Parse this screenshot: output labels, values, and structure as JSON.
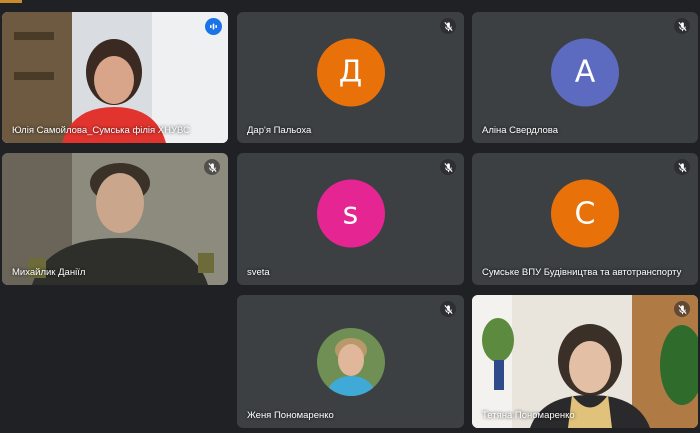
{
  "top_strip_color": "#c98b2c",
  "participants": [
    {
      "name": "Юлія Самойлова_Сумська філія ХНУВС",
      "type": "video",
      "speaking": true
    },
    {
      "name": "Дар'я Пальоха",
      "type": "avatar",
      "initial": "Д",
      "color": "#e8710a",
      "muted": true
    },
    {
      "name": "Аліна Свердлова",
      "type": "avatar",
      "initial": "А",
      "color": "#5c6bc0",
      "muted": true
    },
    {
      "name": "Михайлик Даніїл",
      "type": "video",
      "muted": true
    },
    {
      "name": "sveta",
      "type": "avatar",
      "initial": "s",
      "color": "#e52592",
      "muted": true
    },
    {
      "name": "Сумське ВПУ Будівництва та автотранспорту",
      "type": "avatar",
      "initial": "С",
      "color": "#e8710a",
      "muted": true
    },
    {
      "name": "Женя Пономаренко",
      "type": "photo-avatar",
      "muted": true
    },
    {
      "name": "Тетяна Пономаренко",
      "type": "video",
      "muted": true
    }
  ],
  "icons": {
    "muted": "mic-off-icon",
    "speaking": "audio-level-icon"
  }
}
